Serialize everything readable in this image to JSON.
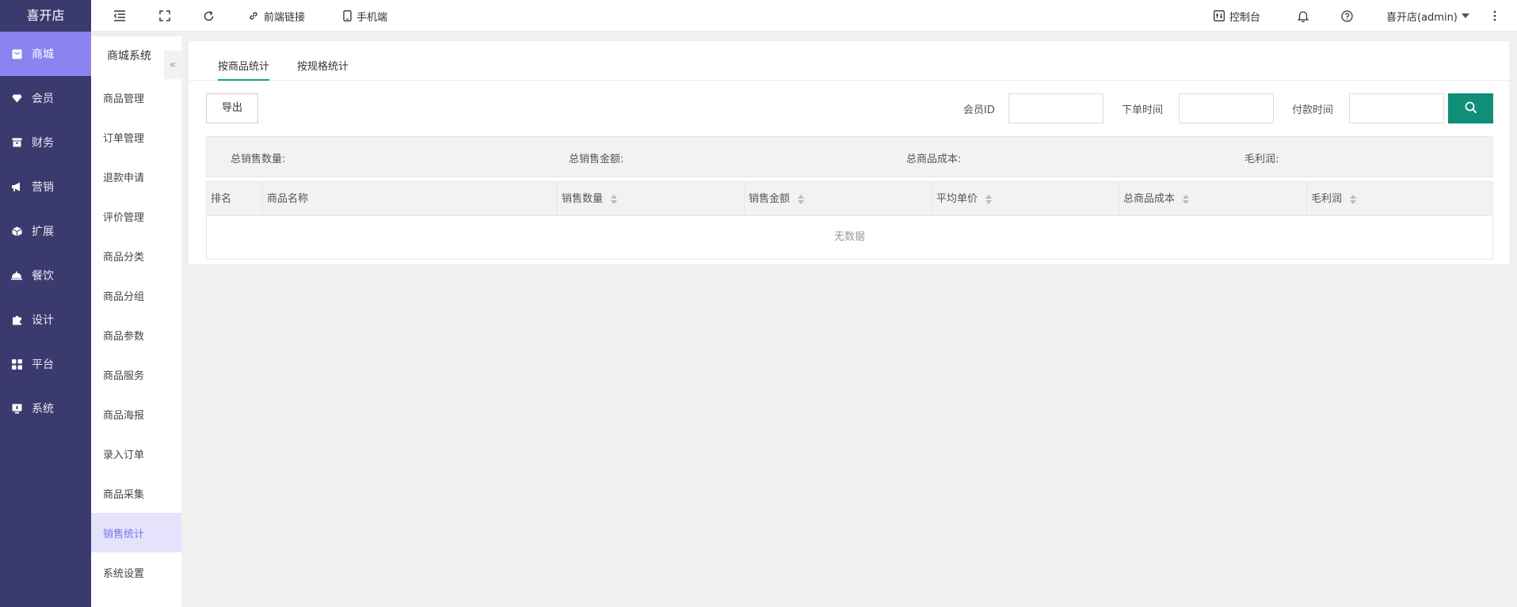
{
  "app": {
    "logo": "喜开店"
  },
  "sidebar": {
    "items": [
      {
        "label": "商城",
        "icon": "shop-icon",
        "active": true
      },
      {
        "label": "会员",
        "icon": "diamond-icon"
      },
      {
        "label": "财务",
        "icon": "wallet-icon"
      },
      {
        "label": "营销",
        "icon": "megaphone-icon"
      },
      {
        "label": "扩展",
        "icon": "cube-icon"
      },
      {
        "label": "餐饮",
        "icon": "food-cover-icon"
      },
      {
        "label": "设计",
        "icon": "puzzle-icon"
      },
      {
        "label": "平台",
        "icon": "grid-icon"
      },
      {
        "label": "系统",
        "icon": "monitor-icon"
      }
    ]
  },
  "subbar": {
    "title": "商城系统",
    "collapse_glyph": "«",
    "items": [
      {
        "label": "商品管理"
      },
      {
        "label": "订单管理"
      },
      {
        "label": "退款申请"
      },
      {
        "label": "评价管理"
      },
      {
        "label": "商品分类"
      },
      {
        "label": "商品分组"
      },
      {
        "label": "商品参数"
      },
      {
        "label": "商品服务"
      },
      {
        "label": "商品海报"
      },
      {
        "label": "录入订单"
      },
      {
        "label": "商品采集"
      },
      {
        "label": "销售统计",
        "active": true
      },
      {
        "label": "系统设置"
      }
    ]
  },
  "topbar": {
    "frontend_link": "前端链接",
    "mobile": "手机端",
    "console": "控制台",
    "user": "喜开店(admin)"
  },
  "tabs": [
    {
      "label": "按商品统计",
      "active": true
    },
    {
      "label": "按规格统计"
    }
  ],
  "filters": {
    "export_label": "导出",
    "member_id_label": "会员ID",
    "member_id_value": "",
    "order_time_label": "下单时间",
    "order_time_value": "",
    "pay_time_label": "付款时间",
    "pay_time_value": ""
  },
  "summary": {
    "total_qty": "总销售数量:",
    "total_amount": "总销售金额:",
    "total_cost": "总商品成本:",
    "gross_profit": "毛利润:"
  },
  "table": {
    "columns": [
      "排名",
      "商品名称",
      "销售数量",
      "销售金额",
      "平均单价",
      "总商品成本",
      "毛利润"
    ],
    "empty_text": "无数据"
  },
  "colors": {
    "sidebar_bg": "#3b3a6e",
    "sidebar_active": "#8a83f0",
    "accent_green": "#17a47a",
    "search_btn": "#118e78",
    "subbar_active_text": "#7a72e6"
  }
}
